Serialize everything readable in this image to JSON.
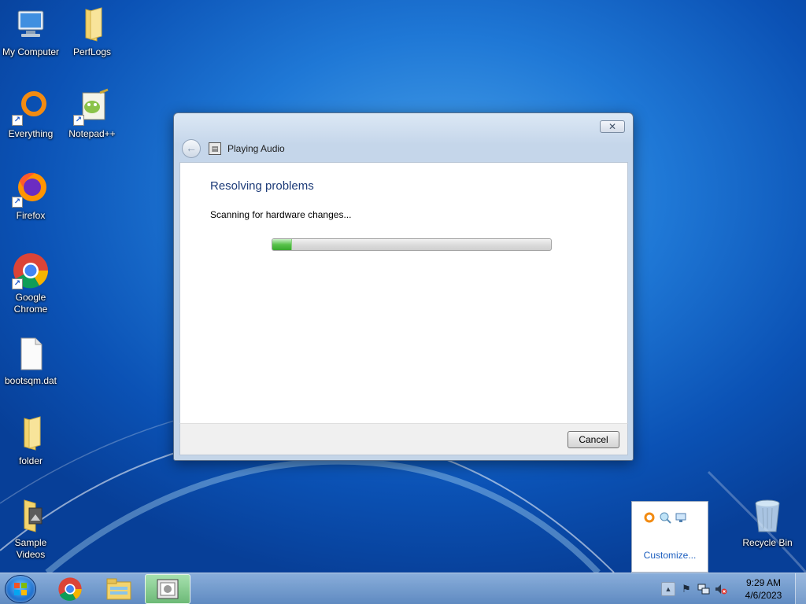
{
  "desktop": {
    "icons": [
      {
        "label": "My Computer",
        "icon": "computer-icon"
      },
      {
        "label": "PerfLogs",
        "icon": "folder-icon"
      },
      {
        "label": "Everything",
        "icon": "everything-icon"
      },
      {
        "label": "Notepad++",
        "icon": "notepadpp-icon"
      },
      {
        "label": "Firefox",
        "icon": "firefox-icon"
      },
      {
        "label": "Google Chrome",
        "icon": "chrome-icon"
      },
      {
        "label": "bootsqm.dat",
        "icon": "file-icon"
      },
      {
        "label": "folder",
        "icon": "folder-icon"
      },
      {
        "label": "Sample Videos",
        "icon": "video-folder-icon"
      },
      {
        "label": "Recycle Bin",
        "icon": "recycle-bin-icon"
      }
    ]
  },
  "dialog": {
    "close_label": "✕",
    "title": "Playing Audio",
    "heading": "Resolving problems",
    "status": "Scanning for hardware changes...",
    "progress_fraction": 0.07,
    "cancel_label": "Cancel"
  },
  "tray_popup": {
    "customize_label": "Customize..."
  },
  "taskbar": {
    "pinned": [
      "start-orb-icon",
      "chrome-icon",
      "explorer-icon",
      "troubleshooter-icon"
    ],
    "clock_time": "9:29 AM",
    "clock_date": "4/6/2023",
    "tray_icons": [
      "show-hidden-icons-arrow",
      "action-center-flag-icon",
      "network-icon",
      "volume-muted-icon"
    ]
  }
}
